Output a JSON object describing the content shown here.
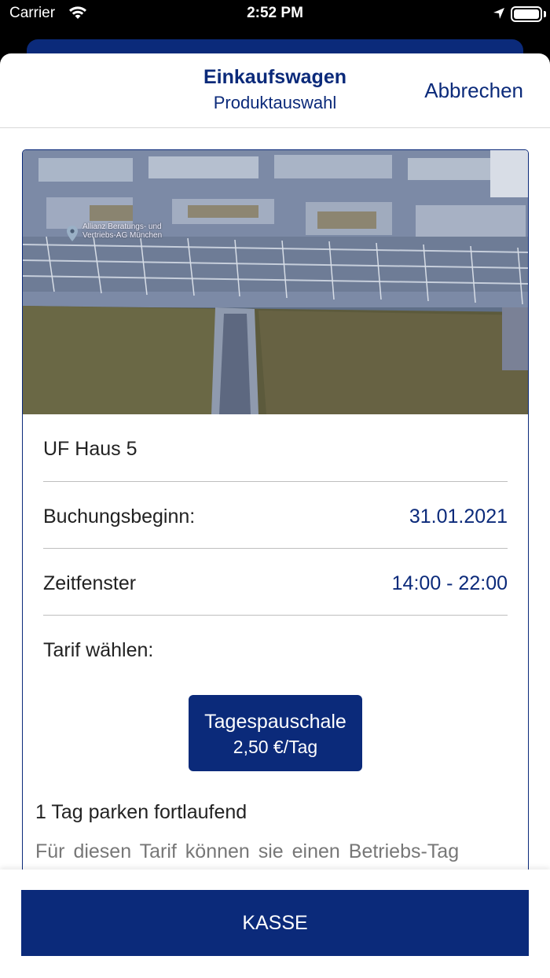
{
  "status_bar": {
    "carrier": "Carrier",
    "time": "2:52 PM"
  },
  "nav": {
    "title": "Einkaufswagen",
    "subtitle": "Produktauswahl",
    "cancel": "Abbrechen"
  },
  "photo": {
    "map_label": "Allianz Beratungs- und Vertriebs-AG München"
  },
  "product": {
    "name": "UF Haus 5",
    "start_label": "Buchungsbeginn:",
    "start_value": "31.01.2021",
    "window_label": "Zeitfenster",
    "window_value": "14:00 - 22:00",
    "tariff_label": "Tarif wählen:"
  },
  "tariff": {
    "name": "Tagespauschale",
    "price": "2,50 €/Tag"
  },
  "description": {
    "title": "1 Tag parken fortlaufend",
    "text": "Für diesen Tarif können sie einen Betriebs-Tag"
  },
  "checkout": {
    "label": "KASSE"
  },
  "colors": {
    "accent": "#0b2a7a"
  }
}
